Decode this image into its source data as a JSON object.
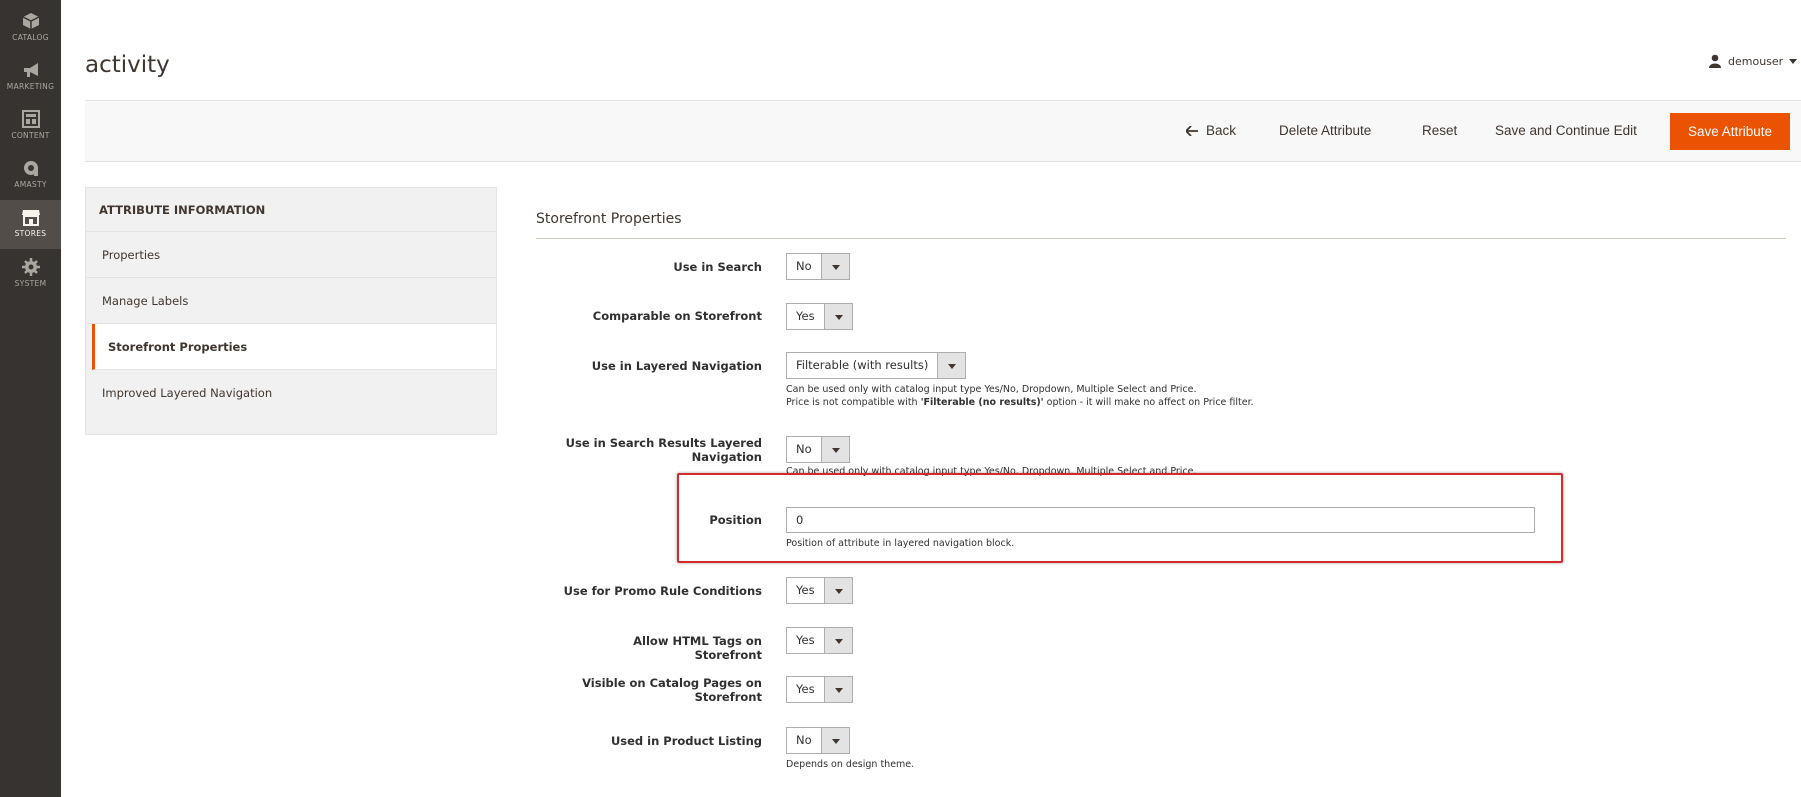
{
  "sidebar": {
    "items": [
      {
        "label": "CATALOG",
        "icon": "cube-icon"
      },
      {
        "label": "MARKETING",
        "icon": "megaphone-icon"
      },
      {
        "label": "CONTENT",
        "icon": "layout-icon"
      },
      {
        "label": "AMASTY",
        "icon": "amasty-logo-icon"
      },
      {
        "label": "STORES",
        "icon": "store-icon"
      },
      {
        "label": "SYSTEM",
        "icon": "gear-icon"
      }
    ]
  },
  "header": {
    "title": "activity",
    "user": "demouser"
  },
  "actions": {
    "back": "Back",
    "delete": "Delete Attribute",
    "reset": "Reset",
    "save_continue": "Save and Continue Edit",
    "save": "Save Attribute"
  },
  "tabs": {
    "heading": "ATTRIBUTE INFORMATION",
    "items": [
      "Properties",
      "Manage Labels",
      "Storefront Properties",
      "Improved Layered Navigation"
    ]
  },
  "section": {
    "title": "Storefront Properties",
    "fields": {
      "use_in_search": {
        "label": "Use in Search",
        "value": "No"
      },
      "comparable": {
        "label": "Comparable on Storefront",
        "value": "Yes"
      },
      "layered_nav": {
        "label": "Use in Layered Navigation",
        "value": "Filterable (with results)",
        "note1": "Can be used only with catalog input type Yes/No, Dropdown, Multiple Select and Price.",
        "note2_pre": "Price is not compatible with ",
        "note2_bold": "'Filterable (no results)'",
        "note2_post": " option - it will make no affect on Price filter."
      },
      "search_layered_nav": {
        "label": "Use in Search Results Layered Navigation",
        "value": "No",
        "note": "Can be used only with catalog input type Yes/No, Dropdown, Multiple Select and Price."
      },
      "position": {
        "label": "Position",
        "value": "0",
        "note": "Position of attribute in layered navigation block."
      },
      "promo_rules": {
        "label": "Use for Promo Rule Conditions",
        "value": "Yes"
      },
      "html_tags": {
        "label": "Allow HTML Tags on Storefront",
        "value": "Yes"
      },
      "visible_catalog": {
        "label": "Visible on Catalog Pages on Storefront",
        "value": "Yes"
      },
      "product_listing": {
        "label": "Used in Product Listing",
        "value": "No",
        "note": "Depends on design theme."
      }
    }
  },
  "colors": {
    "accent": "#eb5202",
    "sidebar": "#373330",
    "highlight": "#d42a2a"
  }
}
